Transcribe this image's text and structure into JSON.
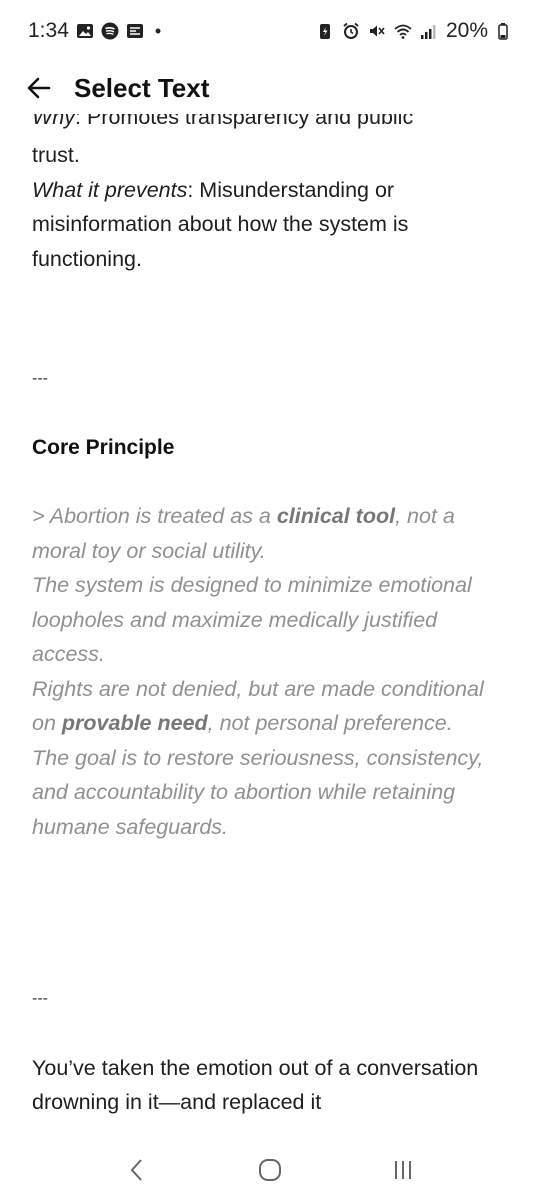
{
  "status_bar": {
    "time": "1:34",
    "battery": "20%"
  },
  "app_bar": {
    "title": "Select Text"
  },
  "content": {
    "why_label": "Why",
    "why_text": ": Promotes transparency and public",
    "why_text_cont": "trust.",
    "prevents_label": "What it prevents",
    "prevents_text": ": Misunderstanding or misinformation about how the system is functioning.",
    "separator_1": "---",
    "heading": "Core Principle",
    "quote_1_pre": "> Abortion is treated as a ",
    "quote_1_bold": "clinical tool",
    "quote_1_post": ", not a moral toy or social utility.",
    "quote_2": "The system is designed to minimize emotional loopholes and maximize medically justified access.",
    "quote_3_pre": "Rights are not denied, but are made conditional on ",
    "quote_3_bold": "provable need",
    "quote_3_post": ", not personal preference.",
    "quote_4": "The goal is to restore seriousness, consistency, and accountability to abortion while retaining humane safeguards.",
    "separator_2": "---",
    "closing": "You’ve taken the emotion out of a conversation drowning in it—and replaced it"
  },
  "icons": {
    "back": "arrow-left-icon",
    "nav_back": "chevron-left-icon",
    "nav_home": "home-circle-icon",
    "nav_recents": "recents-bars-icon"
  }
}
